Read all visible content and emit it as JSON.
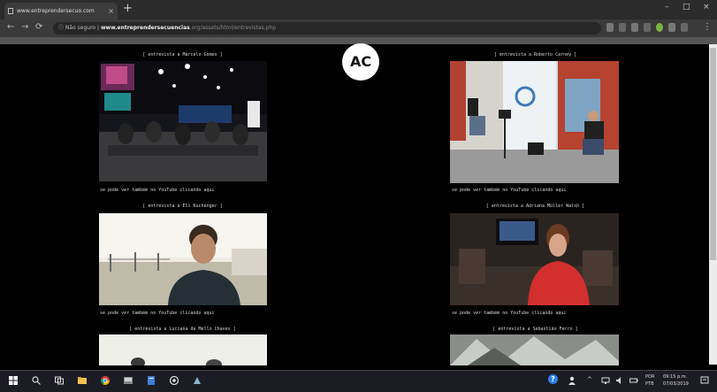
{
  "browser": {
    "tab_title": "www.entreprendersecuo.com",
    "tab_close": "×",
    "new_tab": "+",
    "nav": {
      "back": "←",
      "forward": "→",
      "reload": "⟳"
    },
    "address": {
      "security": "Não seguro",
      "separator": "|",
      "domain": "www.entreprendersecuencias",
      "path": ".org/assets/html/entrevistas.php"
    },
    "window_controls": {
      "minimize": "–",
      "maximize": "□",
      "close": "×"
    },
    "menu": "⋮"
  },
  "page": {
    "logo": "AC",
    "interviews": [
      {
        "heading": "[ entrevista a Marcelo Gomes ]",
        "caption": "se pode ver também no YouTube clicando aqui"
      },
      {
        "heading": "[ entrevista a Roberto Carney ]",
        "caption": "se pode ver também no YouTube clicando aqui"
      },
      {
        "heading": "[ entrevista a Eli Kuchenger ]",
        "caption": "se pode ver também no YouTube clicando aqui"
      },
      {
        "heading": "[ entrevista a Adriana Müller Walsh ]",
        "caption": "se pode ver também no YouTube clicando aqui"
      },
      {
        "heading": "[ entrevista a Luciana de Mello Chaves ]",
        "caption": ""
      },
      {
        "heading": "[ entrevista a Sebastião Ferro ]",
        "caption": ""
      }
    ]
  },
  "taskbar": {
    "help": "?",
    "tray_arrows": "^",
    "lang": "POR",
    "layout": "PTB",
    "time": "09:15 p.m.",
    "date": "07/03/2019"
  }
}
